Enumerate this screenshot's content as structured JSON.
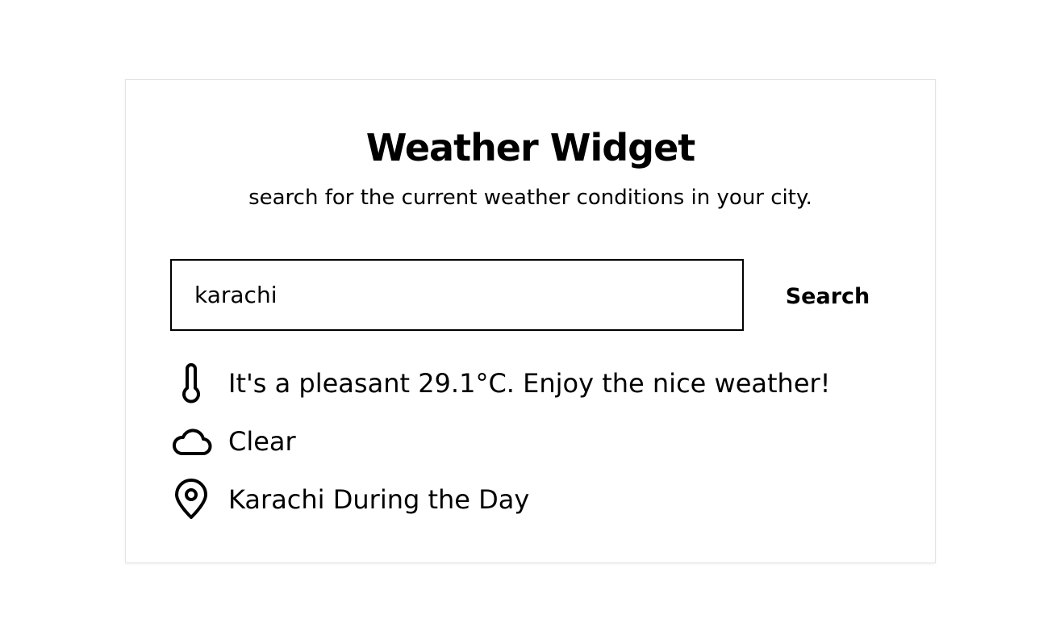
{
  "widget": {
    "title": "Weather Widget",
    "subtitle": "search for the current weather conditions in your city."
  },
  "search": {
    "value": "karachi",
    "placeholder": "",
    "button_label": "Search"
  },
  "results": {
    "temperature": {
      "icon": "thermometer-icon",
      "text": "It's a pleasant 29.1°C. Enjoy the nice weather!"
    },
    "condition": {
      "icon": "cloud-icon",
      "text": "Clear"
    },
    "location": {
      "icon": "map-pin-icon",
      "text": "Karachi During the Day"
    }
  },
  "colors": {
    "text": "#000000",
    "card_border": "#e3e3e3",
    "background": "#ffffff"
  }
}
